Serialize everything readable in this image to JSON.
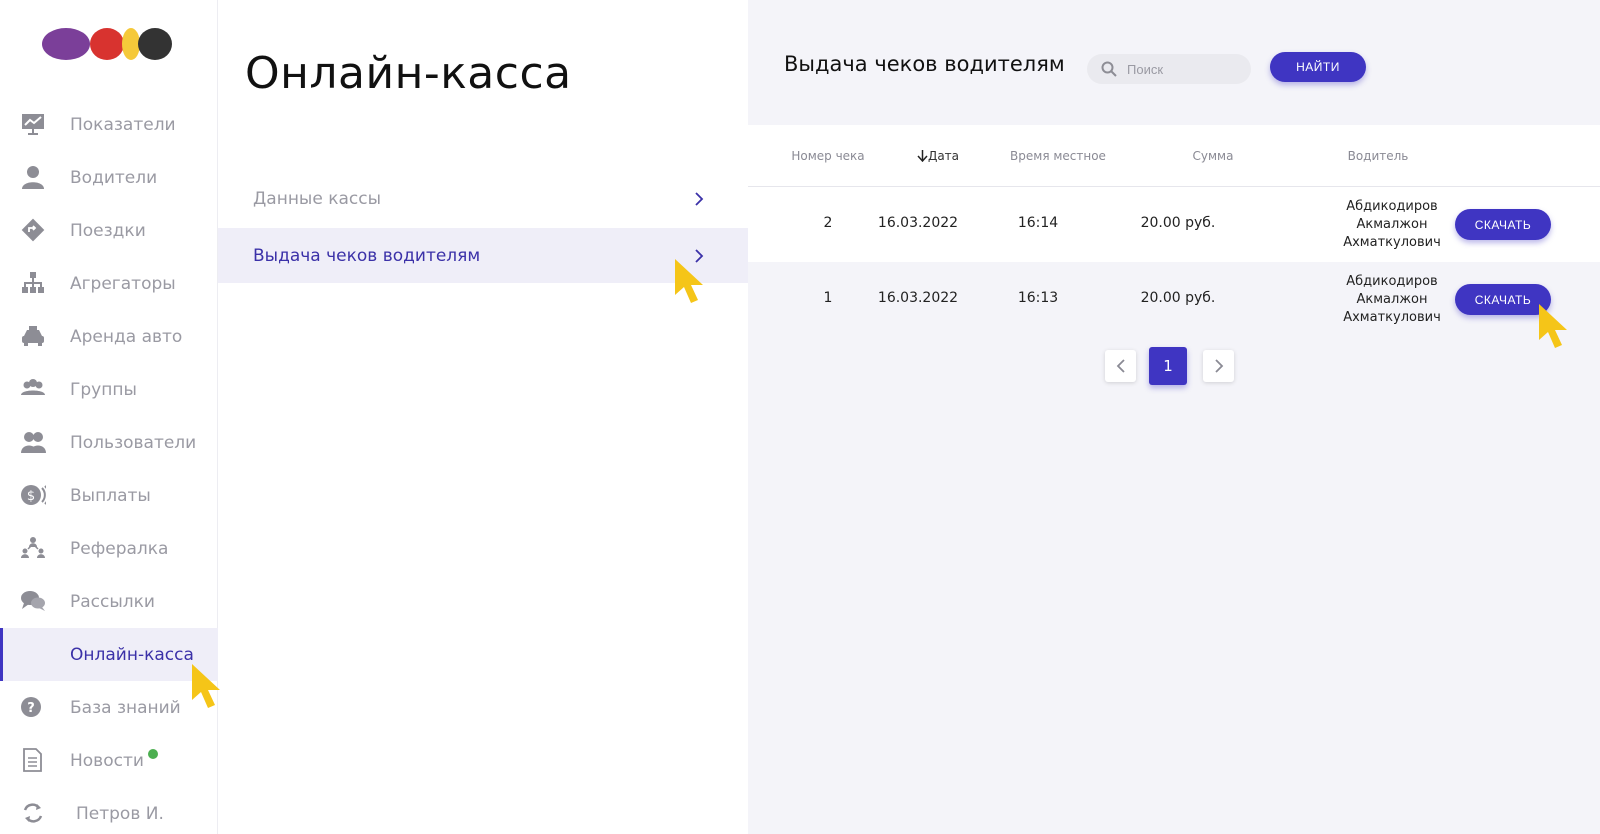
{
  "sidebar": {
    "logo_colors": [
      "#7b3f99",
      "#d8332f",
      "#f5c93a",
      "#333333"
    ],
    "items": [
      {
        "label": "Показатели",
        "icon": "chart-presentation-icon"
      },
      {
        "label": "Водители",
        "icon": "user-icon"
      },
      {
        "label": "Поездки",
        "icon": "route-sign-icon"
      },
      {
        "label": "Агрегаторы",
        "icon": "hierarchy-icon"
      },
      {
        "label": "Аренда авто",
        "icon": "car-icon"
      },
      {
        "label": "Группы",
        "icon": "group-icon"
      },
      {
        "label": "Пользователи",
        "icon": "users-icon"
      },
      {
        "label": "Выплаты",
        "icon": "dollar-coin-icon"
      },
      {
        "label": "Рефералка",
        "icon": "referral-icon"
      },
      {
        "label": "Рассылки",
        "icon": "chat-bubbles-icon"
      },
      {
        "label": "Онлайн-касса",
        "icon": ""
      },
      {
        "label": "База знаний",
        "icon": "question-circle-icon"
      },
      {
        "label": "Новости",
        "icon": "document-icon"
      }
    ],
    "user_label": "Петров И."
  },
  "middle": {
    "title": "Онлайн-касса",
    "menu": [
      {
        "label": "Данные кассы"
      },
      {
        "label": "Выдача чеков водителям"
      }
    ]
  },
  "right": {
    "title": "Выдача чеков водителям",
    "search_placeholder": "Поиск",
    "find_label": "НАЙТИ",
    "columns": [
      "Номер чека",
      "Дата",
      "Время местное",
      "Сумма",
      "Водитель"
    ],
    "rows": [
      {
        "number": "2",
        "date": "16.03.2022",
        "time": "16:14",
        "sum": "20.00 руб.",
        "driver": [
          "Абдикодиров",
          "Акмалжон",
          "Ахматкулович"
        ],
        "action": "СКАЧАТЬ"
      },
      {
        "number": "1",
        "date": "16.03.2022",
        "time": "16:13",
        "sum": "20.00 руб.",
        "driver": [
          "Абдикодиров",
          "Акмалжон",
          "Ахматкулович"
        ],
        "action": "СКАЧАТЬ"
      }
    ],
    "pagination": {
      "current": "1"
    }
  },
  "colors": {
    "accent": "#3f35c2",
    "active_bg": "#efeef8",
    "cursor": "#f5c518"
  }
}
